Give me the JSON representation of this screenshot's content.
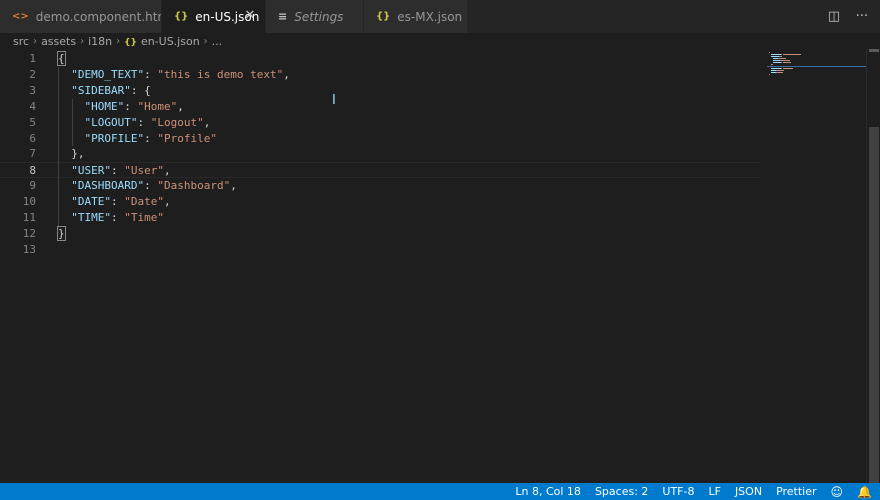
{
  "tabs": [
    {
      "label": "demo.component.html",
      "icon": "html-file-icon",
      "glyph": "<>",
      "active": false,
      "italic": false
    },
    {
      "label": "en-US.json",
      "icon": "json-file-icon",
      "glyph": "{}",
      "active": true,
      "italic": false
    },
    {
      "label": "Settings",
      "icon": "settings-file-icon",
      "glyph": "≡",
      "active": false,
      "italic": true
    },
    {
      "label": "es-MX.json",
      "icon": "json-file-icon",
      "glyph": "{}",
      "active": false,
      "italic": false
    }
  ],
  "tab_close_glyph": "✕",
  "tab_actions": {
    "split": "◫",
    "more": "···"
  },
  "breadcrumb": {
    "items": [
      "src",
      "assets",
      "i18n",
      "en-US.json",
      "..."
    ],
    "separator": "›",
    "json_glyph": "{}"
  },
  "editor": {
    "current_line": 8,
    "lines": [
      {
        "n": "1",
        "tokens": [
          {
            "t": "{",
            "c": "p",
            "box": true
          }
        ]
      },
      {
        "n": "2",
        "tokens": [
          {
            "t": "  ",
            "c": "p"
          },
          {
            "t": "\"DEMO_TEXT\"",
            "c": "k"
          },
          {
            "t": ": ",
            "c": "p"
          },
          {
            "t": "\"this is demo text\"",
            "c": "s"
          },
          {
            "t": ",",
            "c": "p"
          }
        ]
      },
      {
        "n": "3",
        "tokens": [
          {
            "t": "  ",
            "c": "p"
          },
          {
            "t": "\"SIDEBAR\"",
            "c": "k"
          },
          {
            "t": ": {",
            "c": "p"
          }
        ]
      },
      {
        "n": "4",
        "tokens": [
          {
            "t": "    ",
            "c": "p"
          },
          {
            "t": "\"HOME\"",
            "c": "k"
          },
          {
            "t": ": ",
            "c": "p"
          },
          {
            "t": "\"Home\"",
            "c": "s"
          },
          {
            "t": ",",
            "c": "p"
          }
        ]
      },
      {
        "n": "5",
        "tokens": [
          {
            "t": "    ",
            "c": "p"
          },
          {
            "t": "\"LOGOUT\"",
            "c": "k"
          },
          {
            "t": ": ",
            "c": "p"
          },
          {
            "t": "\"Logout\"",
            "c": "s"
          },
          {
            "t": ",",
            "c": "p"
          }
        ]
      },
      {
        "n": "6",
        "tokens": [
          {
            "t": "    ",
            "c": "p"
          },
          {
            "t": "\"PROFILE\"",
            "c": "k"
          },
          {
            "t": ": ",
            "c": "p"
          },
          {
            "t": "\"Profile\"",
            "c": "s"
          }
        ]
      },
      {
        "n": "7",
        "tokens": [
          {
            "t": "  ",
            "c": "p"
          },
          {
            "t": "},",
            "c": "p"
          }
        ]
      },
      {
        "n": "8",
        "tokens": [
          {
            "t": "  ",
            "c": "p"
          },
          {
            "t": "\"USER\"",
            "c": "k"
          },
          {
            "t": ": ",
            "c": "p"
          },
          {
            "t": "\"User\"",
            "c": "s"
          },
          {
            "t": ",",
            "c": "p"
          }
        ]
      },
      {
        "n": "9",
        "tokens": [
          {
            "t": "  ",
            "c": "p"
          },
          {
            "t": "\"DASHBOARD\"",
            "c": "k"
          },
          {
            "t": ": ",
            "c": "p"
          },
          {
            "t": "\"Dashboard\"",
            "c": "s"
          },
          {
            "t": ",",
            "c": "p"
          }
        ]
      },
      {
        "n": "10",
        "tokens": [
          {
            "t": "  ",
            "c": "p"
          },
          {
            "t": "\"DATE\"",
            "c": "k"
          },
          {
            "t": ": ",
            "c": "p"
          },
          {
            "t": "\"Date\"",
            "c": "s"
          },
          {
            "t": ",",
            "c": "p"
          }
        ]
      },
      {
        "n": "11",
        "tokens": [
          {
            "t": "  ",
            "c": "p"
          },
          {
            "t": "\"TIME\"",
            "c": "k"
          },
          {
            "t": ": ",
            "c": "p"
          },
          {
            "t": "\"Time\"",
            "c": "s"
          }
        ]
      },
      {
        "n": "12",
        "tokens": [
          {
            "t": "}",
            "c": "p",
            "box": true
          }
        ]
      },
      {
        "n": "13",
        "tokens": []
      }
    ]
  },
  "statusbar": {
    "position": "Ln 8, Col 18",
    "spaces": "Spaces: 2",
    "encoding": "UTF-8",
    "eol": "LF",
    "language": "JSON",
    "formatter": "Prettier",
    "feedback_glyph": "☺",
    "bell_glyph": "🔔"
  },
  "colors": {
    "editor_bg": "#1e1e1e",
    "tabbar_bg": "#252526",
    "status_bg": "#007acc",
    "key": "#9cdcfe",
    "string": "#ce9178"
  }
}
